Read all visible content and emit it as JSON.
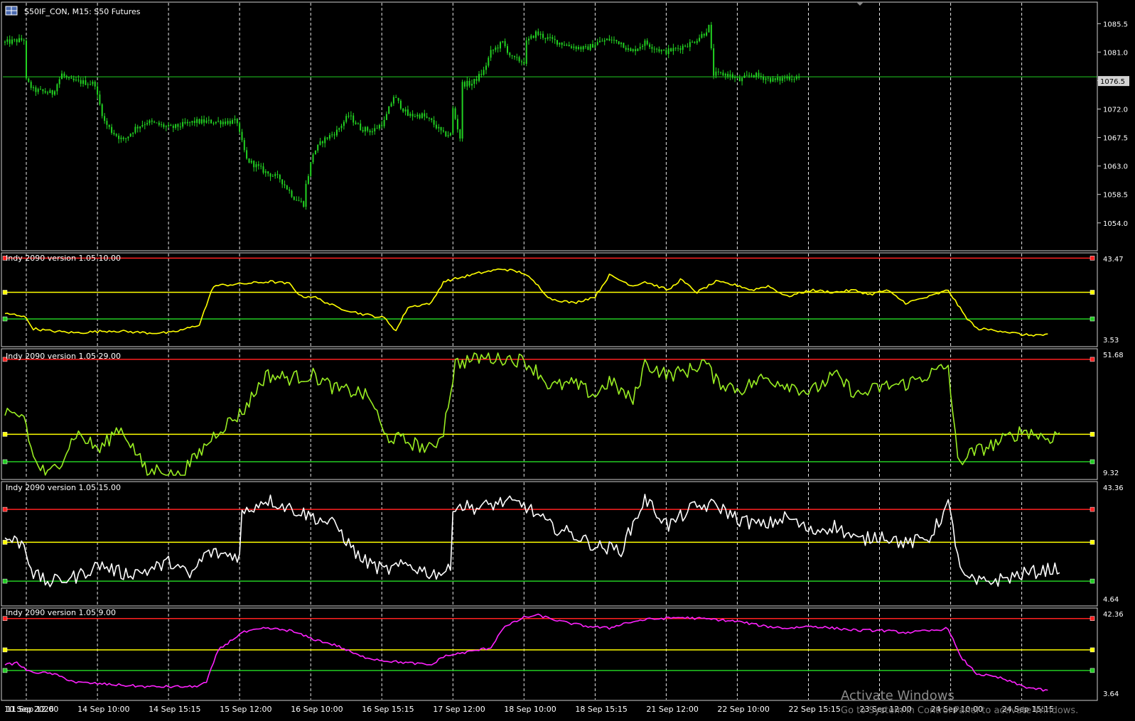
{
  "app": {
    "symbol_label": "S50IF_CON, M15:  S50 Futures"
  },
  "colors": {
    "background": "#000000",
    "border": "#d0d0d0",
    "candle": "#22d322",
    "red_level": "#ff2020",
    "yellow_level": "#ffff00",
    "green_level": "#22cc22",
    "ind1": "#ffff00",
    "ind2": "#99ee22",
    "ind3": "#ffffff",
    "ind4": "#ff22ff",
    "price_label_bg": "#d4d4d4",
    "price_label_text": "#000000"
  },
  "time_axis": {
    "labels": [
      "10 Sep 2026",
      "11 Sep 12:00",
      "14 Sep 10:00",
      "14 Sep 15:15",
      "15 Sep 12:00",
      "16 Sep 10:00",
      "16 Sep 15:15",
      "17 Sep 12:00",
      "18 Sep 10:00",
      "18 Sep 15:15",
      "21 Sep 12:00",
      "22 Sep 10:00",
      "22 Sep 15:15",
      "23 Sep 12:00",
      "24 Sep 10:00",
      "24 Sep 15:15"
    ],
    "day_separator_bars": [
      9,
      39,
      69,
      99,
      129,
      159,
      189,
      219,
      249,
      279,
      309,
      339,
      369,
      399,
      429
    ],
    "last_bar_index": 460
  },
  "chart_data": [
    {
      "type": "candlestick",
      "title": "S50IF_CON, M15:  S50 Futures",
      "ylim": [
        1050.5,
        1088.0
      ],
      "y_ticks": [
        "1085.5",
        "1081.0",
        "1076.5",
        "1072.0",
        "1067.5",
        "1063.0",
        "1058.5",
        "1054.0"
      ],
      "current_price": "1076.5",
      "current_price_line": 1077.1,
      "anchors": [
        [
          0,
          1082.5
        ],
        [
          8,
          1083
        ],
        [
          9,
          1076.5
        ],
        [
          12,
          1075
        ],
        [
          20,
          1074.5
        ],
        [
          24,
          1077.5
        ],
        [
          27,
          1076.5
        ],
        [
          38,
          1076
        ],
        [
          39,
          1074
        ],
        [
          42,
          1070
        ],
        [
          45,
          1068.5
        ],
        [
          50,
          1067
        ],
        [
          55,
          1069
        ],
        [
          60,
          1070
        ],
        [
          70,
          1069
        ],
        [
          80,
          1070
        ],
        [
          90,
          1070
        ],
        [
          98,
          1070
        ],
        [
          99,
          1068
        ],
        [
          102,
          1064
        ],
        [
          106,
          1063
        ],
        [
          110,
          1062
        ],
        [
          116,
          1061
        ],
        [
          122,
          1058
        ],
        [
          126,
          1057
        ],
        [
          127,
          1060
        ],
        [
          130,
          1065
        ],
        [
          134,
          1067
        ],
        [
          140,
          1068.5
        ],
        [
          145,
          1071
        ],
        [
          150,
          1069
        ],
        [
          155,
          1068.5
        ],
        [
          160,
          1070
        ],
        [
          164,
          1074
        ],
        [
          170,
          1071
        ],
        [
          176,
          1071
        ],
        [
          180,
          1070
        ],
        [
          185,
          1068
        ],
        [
          192,
          1067.5
        ],
        [
          188,
          1068
        ],
        [
          189,
          1072
        ],
        [
          192,
          1076
        ],
        [
          197,
          1076
        ],
        [
          202,
          1078
        ],
        [
          205,
          1081
        ],
        [
          210,
          1082.5
        ],
        [
          214,
          1080
        ],
        [
          219,
          1079.5
        ],
        [
          220,
          1082.5
        ],
        [
          224,
          1084
        ],
        [
          230,
          1083
        ],
        [
          238,
          1082
        ],
        [
          245,
          1081.5
        ],
        [
          250,
          1082.5
        ],
        [
          255,
          1083
        ],
        [
          260,
          1082.5
        ],
        [
          264,
          1081
        ],
        [
          270,
          1082.5
        ],
        [
          278,
          1081
        ],
        [
          283,
          1081.5
        ],
        [
          290,
          1082.5
        ],
        [
          295,
          1084
        ],
        [
          297,
          1085
        ],
        [
          299,
          1077.5
        ],
        [
          305,
          1077.5
        ],
        [
          310,
          1076.5
        ],
        [
          315,
          1077.5
        ],
        [
          320,
          1077
        ],
        [
          325,
          1076.5
        ],
        [
          330,
          1077
        ],
        [
          335,
          1077
        ]
      ]
    },
    {
      "type": "line",
      "name": "Indy 2090 version 1.05 10.00",
      "header": "Indy 2090 version 1.05 10.00",
      "ylim": [
        3.53,
        43.47
      ],
      "y_ticks": [
        "43.47",
        "3.53"
      ],
      "levels": {
        "red": 43.0,
        "yellow": 27.0,
        "green": 14.5
      },
      "color": "#ffff00",
      "anchors": [
        [
          0,
          17
        ],
        [
          8,
          16
        ],
        [
          12,
          10
        ],
        [
          18,
          9
        ],
        [
          30,
          8
        ],
        [
          45,
          9
        ],
        [
          60,
          8
        ],
        [
          70,
          8
        ],
        [
          80,
          11
        ],
        [
          82,
          12
        ],
        [
          88,
          30
        ],
        [
          100,
          31
        ],
        [
          112,
          32
        ],
        [
          120,
          31
        ],
        [
          125,
          25
        ],
        [
          130,
          25
        ],
        [
          140,
          20
        ],
        [
          150,
          17
        ],
        [
          160,
          15
        ],
        [
          165,
          9
        ],
        [
          170,
          20
        ],
        [
          180,
          22
        ],
        [
          185,
          32
        ],
        [
          200,
          36
        ],
        [
          210,
          38
        ],
        [
          219,
          36
        ],
        [
          225,
          30
        ],
        [
          230,
          24
        ],
        [
          240,
          22
        ],
        [
          249,
          25
        ],
        [
          255,
          35
        ],
        [
          265,
          30
        ],
        [
          270,
          32
        ],
        [
          280,
          28
        ],
        [
          285,
          33
        ],
        [
          292,
          27
        ],
        [
          300,
          32
        ],
        [
          310,
          30
        ],
        [
          315,
          28
        ],
        [
          322,
          30
        ],
        [
          330,
          25
        ],
        [
          340,
          28
        ],
        [
          350,
          27
        ],
        [
          358,
          28
        ],
        [
          365,
          26
        ],
        [
          372,
          28
        ],
        [
          380,
          22
        ],
        [
          390,
          25
        ],
        [
          398,
          28
        ],
        [
          405,
          16
        ],
        [
          410,
          10
        ],
        [
          420,
          9
        ],
        [
          430,
          7
        ],
        [
          440,
          7
        ]
      ]
    },
    {
      "type": "line",
      "name": "Indy 2090 version 1.05 29.00",
      "header": "Indy 2090 version 1.05 29.00",
      "ylim": [
        9.32,
        51.68
      ],
      "y_ticks": [
        "51.68",
        "9.32"
      ],
      "levels": {
        "red": 49.5,
        "yellow": 23.5,
        "green": 14.0
      },
      "color": "#99ee22",
      "anchors": [
        [
          0,
          30
        ],
        [
          8,
          30
        ],
        [
          12,
          15
        ],
        [
          18,
          9
        ],
        [
          24,
          15
        ],
        [
          30,
          24
        ],
        [
          40,
          18
        ],
        [
          48,
          26
        ],
        [
          52,
          22
        ],
        [
          60,
          10
        ],
        [
          66,
          12
        ],
        [
          72,
          8
        ],
        [
          80,
          15
        ],
        [
          90,
          25
        ],
        [
          100,
          31
        ],
        [
          110,
          44
        ],
        [
          120,
          43
        ],
        [
          130,
          44
        ],
        [
          140,
          39
        ],
        [
          150,
          38
        ],
        [
          155,
          35
        ],
        [
          160,
          23
        ],
        [
          170,
          21
        ],
        [
          180,
          18
        ],
        [
          185,
          25
        ],
        [
          190,
          48
        ],
        [
          200,
          50
        ],
        [
          210,
          50
        ],
        [
          219,
          49
        ],
        [
          225,
          45
        ],
        [
          230,
          40
        ],
        [
          240,
          41
        ],
        [
          249,
          37
        ],
        [
          255,
          42
        ],
        [
          265,
          35
        ],
        [
          270,
          48
        ],
        [
          280,
          44
        ],
        [
          290,
          46
        ],
        [
          295,
          49
        ],
        [
          300,
          42
        ],
        [
          310,
          39
        ],
        [
          320,
          43
        ],
        [
          330,
          41
        ],
        [
          340,
          38
        ],
        [
          350,
          44
        ],
        [
          360,
          37
        ],
        [
          370,
          40
        ],
        [
          380,
          41
        ],
        [
          398,
          47
        ],
        [
          402,
          14
        ],
        [
          408,
          17
        ],
        [
          420,
          21
        ],
        [
          430,
          25
        ],
        [
          440,
          22
        ],
        [
          445,
          24
        ]
      ]
    },
    {
      "type": "line",
      "name": "Indy 2090 version 1.05 15.00",
      "header": "Indy 2090 version 1.05 15.00",
      "ylim": [
        4.64,
        43.36
      ],
      "y_ticks": [
        "43.36",
        "4.64"
      ],
      "levels": {
        "red": 35.5,
        "yellow": 24.5,
        "green": 11.5
      },
      "color": "#ffffff",
      "anchors": [
        [
          0,
          26
        ],
        [
          8,
          24
        ],
        [
          12,
          14
        ],
        [
          18,
          11
        ],
        [
          30,
          13
        ],
        [
          40,
          17
        ],
        [
          50,
          14
        ],
        [
          60,
          15
        ],
        [
          70,
          18
        ],
        [
          78,
          13
        ],
        [
          85,
          21
        ],
        [
          99,
          20
        ],
        [
          100,
          34
        ],
        [
          110,
          39
        ],
        [
          120,
          36
        ],
        [
          130,
          33
        ],
        [
          140,
          30
        ],
        [
          145,
          24
        ],
        [
          150,
          19
        ],
        [
          160,
          15
        ],
        [
          170,
          17
        ],
        [
          180,
          14
        ],
        [
          188,
          15
        ],
        [
          189,
          37
        ],
        [
          200,
          36
        ],
        [
          210,
          38
        ],
        [
          219,
          37
        ],
        [
          230,
          30
        ],
        [
          240,
          27
        ],
        [
          250,
          23
        ],
        [
          260,
          22
        ],
        [
          270,
          39
        ],
        [
          280,
          30
        ],
        [
          290,
          36
        ],
        [
          300,
          37
        ],
        [
          310,
          32
        ],
        [
          320,
          30
        ],
        [
          330,
          33
        ],
        [
          340,
          28
        ],
        [
          350,
          30
        ],
        [
          360,
          25
        ],
        [
          370,
          27
        ],
        [
          380,
          24
        ],
        [
          390,
          26
        ],
        [
          398,
          37
        ],
        [
          404,
          13
        ],
        [
          410,
          11
        ],
        [
          420,
          12
        ],
        [
          430,
          14
        ],
        [
          445,
          16
        ]
      ]
    },
    {
      "type": "line",
      "name": "Indy 2090 version 1.05 9.00",
      "header": "Indy 2090 version 1.05 9.00",
      "ylim": [
        3.64,
        42.36
      ],
      "y_ticks": [
        "42.36",
        "3.64"
      ],
      "levels": {
        "red": 39.5,
        "yellow": 25.0,
        "green": 15.5
      },
      "color": "#ff22ff",
      "anchors": [
        [
          0,
          18
        ],
        [
          5,
          19
        ],
        [
          10,
          15
        ],
        [
          20,
          14
        ],
        [
          30,
          10
        ],
        [
          45,
          9
        ],
        [
          60,
          8
        ],
        [
          70,
          8
        ],
        [
          80,
          8
        ],
        [
          85,
          10
        ],
        [
          90,
          25
        ],
        [
          100,
          33
        ],
        [
          110,
          35
        ],
        [
          120,
          34
        ],
        [
          130,
          30
        ],
        [
          140,
          27
        ],
        [
          150,
          22
        ],
        [
          160,
          20
        ],
        [
          170,
          19
        ],
        [
          180,
          18
        ],
        [
          185,
          22
        ],
        [
          195,
          24
        ],
        [
          205,
          26
        ],
        [
          210,
          35
        ],
        [
          219,
          40
        ],
        [
          225,
          41
        ],
        [
          235,
          38
        ],
        [
          245,
          36
        ],
        [
          255,
          35
        ],
        [
          260,
          37
        ],
        [
          270,
          39
        ],
        [
          285,
          40
        ],
        [
          300,
          39
        ],
        [
          310,
          38
        ],
        [
          320,
          36
        ],
        [
          330,
          35
        ],
        [
          340,
          36
        ],
        [
          350,
          35
        ],
        [
          360,
          34
        ],
        [
          370,
          34
        ],
        [
          380,
          33
        ],
        [
          392,
          34
        ],
        [
          398,
          35
        ],
        [
          403,
          22
        ],
        [
          410,
          14
        ],
        [
          420,
          12
        ],
        [
          430,
          8
        ],
        [
          440,
          6
        ]
      ]
    }
  ],
  "watermark": {
    "title": "Activate Windows",
    "subtitle": "Go to System in Control Panel to activate Windows."
  }
}
